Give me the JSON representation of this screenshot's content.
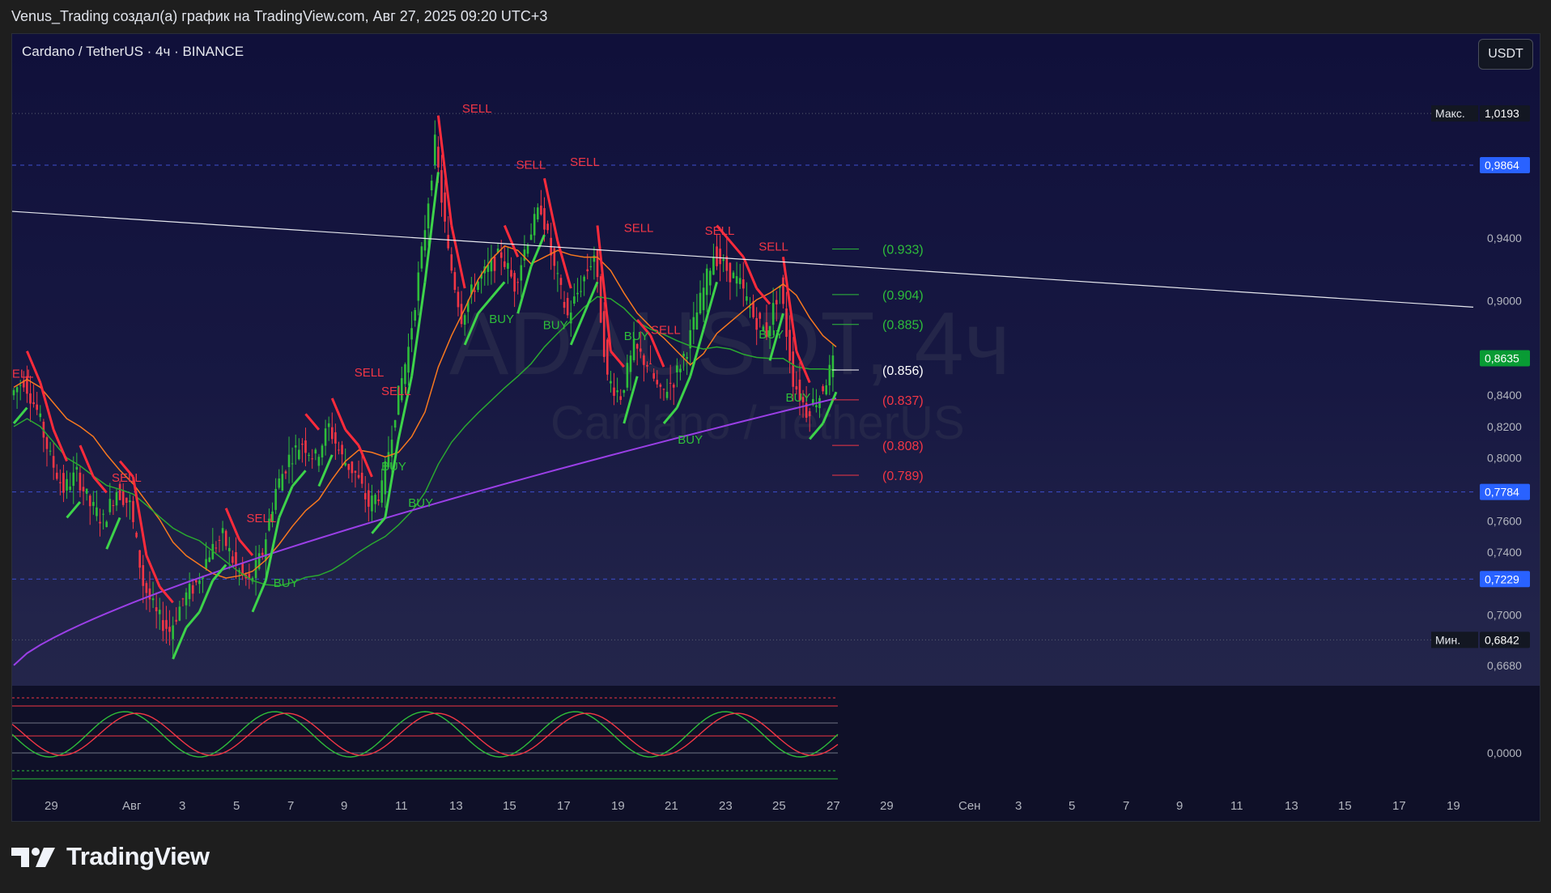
{
  "caption": "Venus_Trading создал(а) график на TradingView.com, Авг 27, 2025 09:20 UTC+3",
  "symbol_title": "Cardano / TetherUS · 4ч · BINANCE",
  "currency_button": "USDT",
  "watermark": {
    "ticker": "ADAUSDT, 4ч",
    "name": "Cardano / TetherUS"
  },
  "brand": "TradingView",
  "colors": {
    "up": "#2ebd3a",
    "down": "#f23645",
    "ma_orange": "#f7781f",
    "ma_green": "#2aa830",
    "ma_purple": "#9a3fe6",
    "price_label": "#2962ff",
    "current_price": "#089b34"
  },
  "chart_data": {
    "type": "candlestick",
    "ylim": [
      0.655,
      1.04
    ],
    "yaxis_ticks": [
      "0,9400",
      "0,9000",
      "0,8400",
      "0,8200",
      "0,8000",
      "0,7600",
      "0,7400",
      "0,7000",
      "0,6680"
    ],
    "xaxis_ticks": [
      "29",
      "Авг",
      "3",
      "5",
      "7",
      "9",
      "11",
      "13",
      "15",
      "17",
      "19",
      "21",
      "23",
      "25",
      "27",
      "29",
      "Сен",
      "3",
      "5",
      "7",
      "9",
      "11",
      "13",
      "15",
      "17",
      "19"
    ],
    "price_labels": {
      "max": {
        "label": "Макс.",
        "value": "1,0193"
      },
      "min": {
        "label": "Мин.",
        "value": "0,6842"
      },
      "levels": [
        "0,9864",
        "0,7784",
        "0,7229"
      ],
      "current": "0,8635"
    },
    "close_path": [
      0.84,
      0.85,
      0.83,
      0.8,
      0.78,
      0.79,
      0.77,
      0.76,
      0.78,
      0.77,
      0.72,
      0.7,
      0.69,
      0.71,
      0.72,
      0.74,
      0.75,
      0.73,
      0.72,
      0.74,
      0.78,
      0.8,
      0.81,
      0.8,
      0.82,
      0.8,
      0.79,
      0.77,
      0.78,
      0.83,
      0.87,
      0.93,
      1.0,
      0.93,
      0.89,
      0.91,
      0.92,
      0.93,
      0.91,
      0.94,
      0.96,
      0.92,
      0.89,
      0.91,
      0.93,
      0.85,
      0.84,
      0.87,
      0.86,
      0.84,
      0.85,
      0.87,
      0.9,
      0.93,
      0.92,
      0.91,
      0.89,
      0.88,
      0.91,
      0.85,
      0.83,
      0.84,
      0.86
    ],
    "supertrend_signals": [
      {
        "label": "SELL",
        "x": "Июл 28",
        "price": 0.851
      },
      {
        "label": "SELL",
        "x": "Авг 1",
        "price": 0.785
      },
      {
        "label": "SELL",
        "x": "Авг 6",
        "price": 0.759
      },
      {
        "label": "BUY",
        "x": "Авг 7",
        "price": 0.718
      },
      {
        "label": "SELL",
        "x": "Авг 10",
        "price": 0.852
      },
      {
        "label": "SELL",
        "x": "Авг 11",
        "price": 0.84
      },
      {
        "label": "BUY",
        "x": "Авг 11",
        "price": 0.792
      },
      {
        "label": "BUY",
        "x": "Авг 12",
        "price": 0.769
      },
      {
        "label": "SELL",
        "x": "Авг 14",
        "price": 1.02
      },
      {
        "label": "BUY",
        "x": "Авг 15",
        "price": 0.886
      },
      {
        "label": "SELL",
        "x": "Авг 16",
        "price": 0.984
      },
      {
        "label": "BUY",
        "x": "Авг 17",
        "price": 0.882
      },
      {
        "label": "SELL",
        "x": "Авг 18",
        "price": 0.986
      },
      {
        "label": "SELL",
        "x": "Авг 20",
        "price": 0.944
      },
      {
        "label": "BUY",
        "x": "Авг 20",
        "price": 0.875
      },
      {
        "label": "SELL",
        "x": "Авг 21",
        "price": 0.879
      },
      {
        "label": "BUY",
        "x": "Авг 22",
        "price": 0.809
      },
      {
        "label": "SELL",
        "x": "Авг 23",
        "price": 0.942
      },
      {
        "label": "SELL",
        "x": "Авг 25",
        "price": 0.932
      },
      {
        "label": "BUY",
        "x": "Авг 25",
        "price": 0.876
      },
      {
        "label": "BUY",
        "x": "Авг 26",
        "price": 0.836
      }
    ],
    "fib_levels": [
      {
        "label": "(0.933)",
        "price": 0.933,
        "color": "#2ebd3a"
      },
      {
        "label": "(0.904)",
        "price": 0.904,
        "color": "#2ebd3a"
      },
      {
        "label": "(0.885)",
        "price": 0.885,
        "color": "#2ebd3a"
      },
      {
        "label": "(0.856)",
        "price": 0.856,
        "color": "#ffffff"
      },
      {
        "label": "(0.837)",
        "price": 0.837,
        "color": "#f23645"
      },
      {
        "label": "(0.808)",
        "price": 0.808,
        "color": "#f23645"
      },
      {
        "label": "(0.789)",
        "price": 0.789,
        "color": "#f23645"
      }
    ],
    "trendline": [
      {
        "x": "Июл 28",
        "price": 0.957
      },
      {
        "x": "Сен 18",
        "price": 0.896
      }
    ],
    "oscillator": {
      "zero_label": "0,0000"
    }
  }
}
